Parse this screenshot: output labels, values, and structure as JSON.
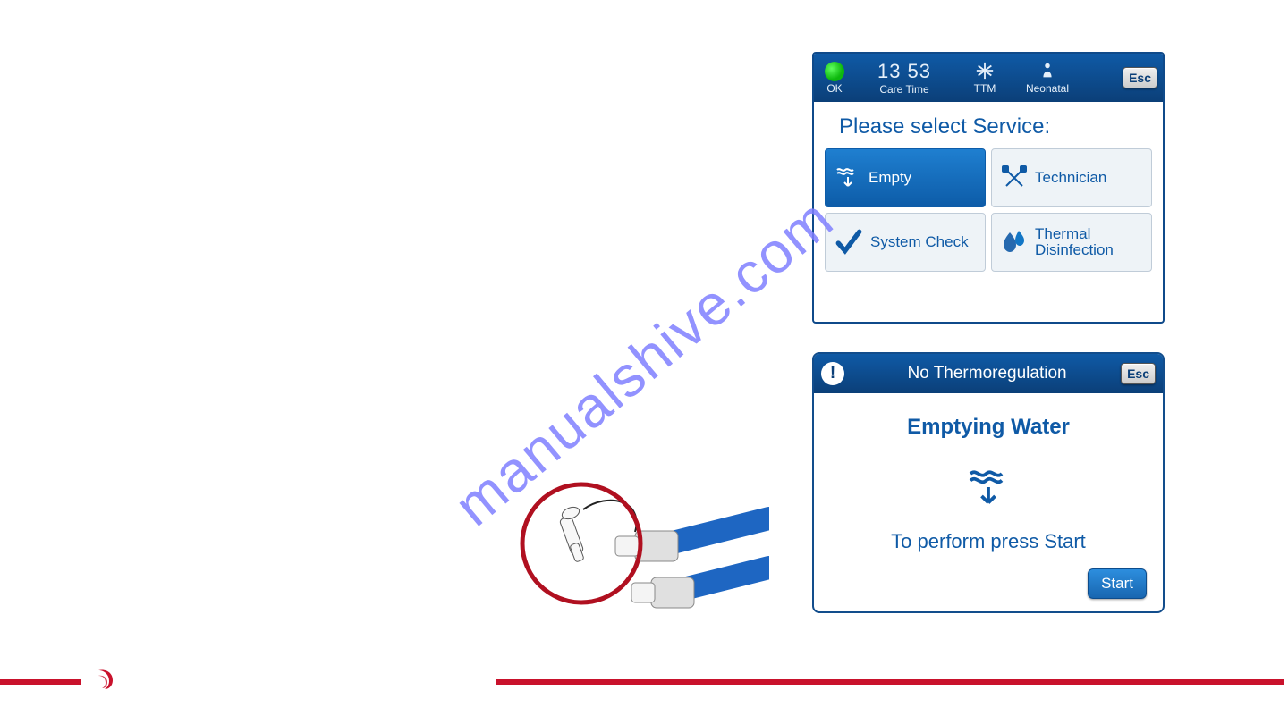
{
  "watermark": "manualshive.com",
  "panel1": {
    "status_label": "OK",
    "time_value": "13 53",
    "time_label": "Care Time",
    "ttm_label": "TTM",
    "neonatal_label": "Neonatal",
    "esc_label": "Esc",
    "title": "Please select Service:",
    "tiles": {
      "empty": "Empty",
      "technician": "Technician",
      "system_check": "System Check",
      "thermal": "Thermal\nDisinfection"
    }
  },
  "panel2": {
    "header": "No Thermoregulation",
    "esc_label": "Esc",
    "title": "Emptying Water",
    "message": "To perform press Start",
    "start_label": "Start"
  }
}
